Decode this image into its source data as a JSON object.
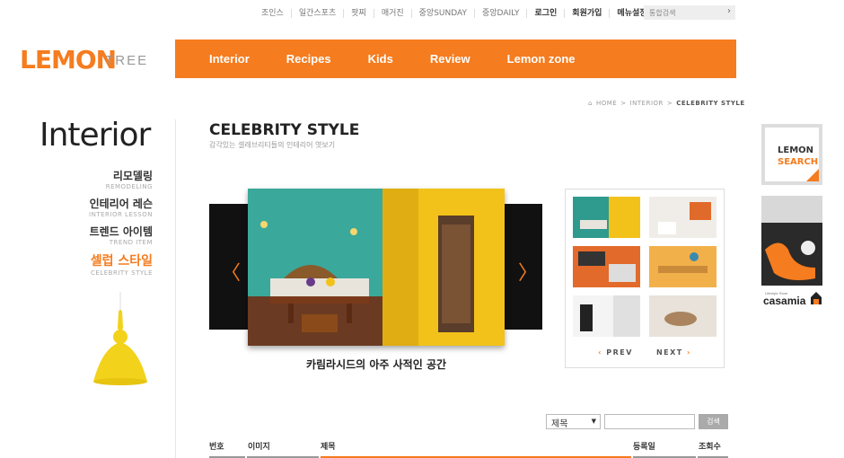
{
  "topbar": {
    "items": [
      "조인스",
      "일간스포츠",
      "팟찌",
      "매거진",
      "중앙SUNDAY",
      "중앙DAILY"
    ],
    "login": "로그인",
    "signup": "회원가입",
    "menu_settings": "메뉴설정"
  },
  "top_search": {
    "placeholder": "통합검색"
  },
  "logo": {
    "main": "LEMON",
    "sub": "TREE"
  },
  "nav": [
    "Interior",
    "Recipes",
    "Kids",
    "Review",
    "Lemon zone"
  ],
  "breadcrumb": {
    "home": "HOME",
    "section": "INTERIOR",
    "current": "CELEBRITY STYLE"
  },
  "sidebar": {
    "title": "Interior",
    "items": [
      {
        "ko": "리모델링",
        "en": "REMODELING"
      },
      {
        "ko": "인테리어 레슨",
        "en": "INTERIOR LESSON"
      },
      {
        "ko": "트렌드 아이템",
        "en": "TREND ITEM"
      },
      {
        "ko": "셀럽 스타일",
        "en": "CELEBRITY STYLE"
      }
    ]
  },
  "content": {
    "title": "CELEBRITY STYLE",
    "subtitle": "감각있는 셀레브리티들의 인테리어 엿보기",
    "caption": "카림라시드의 아주 사적인 공간"
  },
  "thumbnails": {
    "prev": "PREV",
    "next": "NEXT"
  },
  "ads": {
    "search_line1": "LEMON",
    "search_line2": "SEARCH",
    "casamia_small": "Lifestyle Store",
    "casamia": "casamia"
  },
  "board_search": {
    "select_value": "제목",
    "button": "검색"
  },
  "table": {
    "columns": [
      "번호",
      "이미지",
      "제목",
      "등록일",
      "조회수"
    ]
  },
  "colors": {
    "accent": "#f57c1f",
    "lamp": "#f2d21a"
  }
}
